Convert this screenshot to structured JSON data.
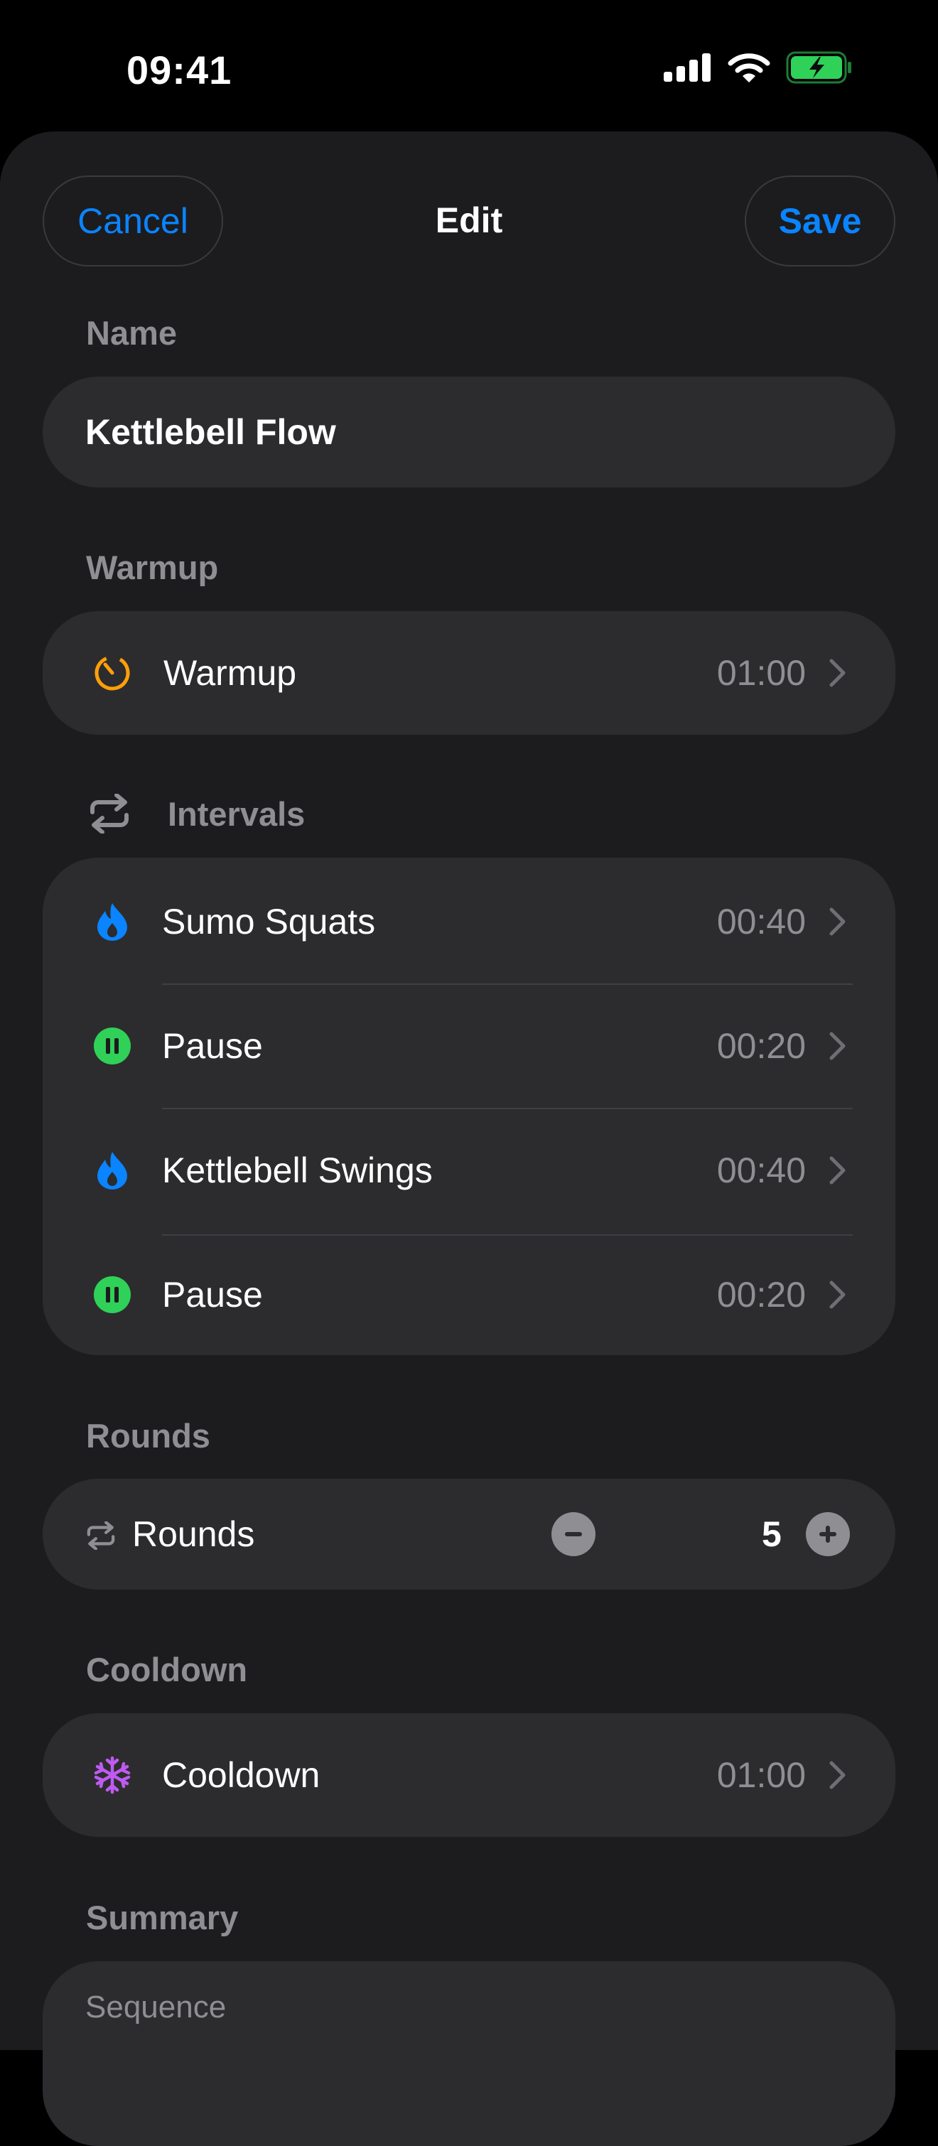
{
  "status": {
    "time": "09:41"
  },
  "nav": {
    "cancel": "Cancel",
    "title": "Edit",
    "save": "Save"
  },
  "name": {
    "section": "Name",
    "value": "Kettlebell Flow"
  },
  "warmup": {
    "section": "Warmup",
    "label": "Warmup",
    "value": "01:00",
    "icon": "timer-icon",
    "color": "#ff9f0a"
  },
  "intervals": {
    "section": "Intervals",
    "items": [
      {
        "label": "Sumo Squats",
        "value": "00:40",
        "icon": "flame-icon",
        "color": "#0a84ff"
      },
      {
        "label": "Pause",
        "value": "00:20",
        "icon": "pause-icon",
        "color": "#30d158"
      },
      {
        "label": "Kettlebell Swings",
        "value": "00:40",
        "icon": "flame-icon",
        "color": "#0a84ff"
      },
      {
        "label": "Pause",
        "value": "00:20",
        "icon": "pause-icon",
        "color": "#30d158"
      }
    ]
  },
  "rounds": {
    "section": "Rounds",
    "label": "Rounds",
    "value": "5"
  },
  "cooldown": {
    "section": "Cooldown",
    "label": "Cooldown",
    "value": "01:00",
    "icon": "snowflake-icon",
    "color": "#bf5af2"
  },
  "summary": {
    "section": "Summary",
    "sequence_label": "Sequence"
  },
  "colors": {
    "accent": "#0a84ff",
    "background": "#1c1c1e",
    "card": "#2c2c2e",
    "secondary_text": "#8e8e93"
  }
}
